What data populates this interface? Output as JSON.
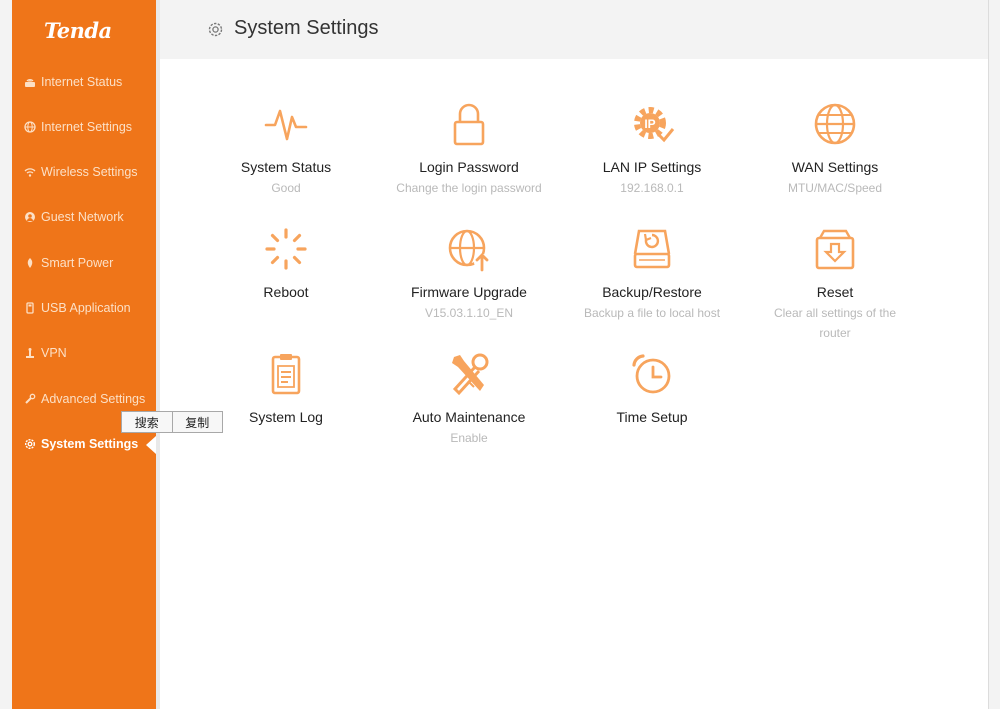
{
  "brand": {
    "logo_text": "Tenda",
    "accent": "#ef7519",
    "icon_color": "#f7a45d"
  },
  "header": {
    "title": "System Settings",
    "icon": "gear-icon"
  },
  "sidebar": {
    "items": [
      {
        "label": "Internet Status",
        "icon": "router-icon",
        "active": false
      },
      {
        "label": "Internet Settings",
        "icon": "globe-icon",
        "active": false
      },
      {
        "label": "Wireless Settings",
        "icon": "wifi-icon",
        "active": false
      },
      {
        "label": "Guest Network",
        "icon": "guest-icon",
        "active": false
      },
      {
        "label": "Smart Power",
        "icon": "power-icon",
        "active": false
      },
      {
        "label": "USB Application",
        "icon": "usb-icon",
        "active": false
      },
      {
        "label": "VPN",
        "icon": "vpn-icon",
        "active": false
      },
      {
        "label": "Advanced Settings",
        "icon": "wrench-icon",
        "active": false
      },
      {
        "label": "System Settings",
        "icon": "gear-icon",
        "active": true
      }
    ]
  },
  "tiles": [
    {
      "label": "System Status",
      "desc": "Good",
      "icon": "pulse-icon"
    },
    {
      "label": "Login Password",
      "desc": "Change the login password",
      "icon": "lock-icon"
    },
    {
      "label": "LAN IP Settings",
      "desc": "192.168.0.1",
      "icon": "ip-gear-icon"
    },
    {
      "label": "WAN Settings",
      "desc": "MTU/MAC/Speed",
      "icon": "globe-icon"
    },
    {
      "label": "Reboot",
      "desc": "",
      "icon": "spinner-icon"
    },
    {
      "label": "Firmware Upgrade",
      "desc": "V15.03.1.10_EN",
      "icon": "globe-upload-icon"
    },
    {
      "label": "Backup/Restore",
      "desc": "Backup a file to local host",
      "icon": "drive-restore-icon"
    },
    {
      "label": "Reset",
      "desc": "Clear all settings of the router",
      "icon": "box-download-icon"
    },
    {
      "label": "System Log",
      "desc": "",
      "icon": "clipboard-icon"
    },
    {
      "label": "Auto Maintenance",
      "desc": "Enable",
      "icon": "tools-icon"
    },
    {
      "label": "Time Setup",
      "desc": "",
      "icon": "alarm-clock-icon"
    }
  ],
  "context_menu": {
    "search_label": "搜索",
    "copy_label": "复制"
  }
}
